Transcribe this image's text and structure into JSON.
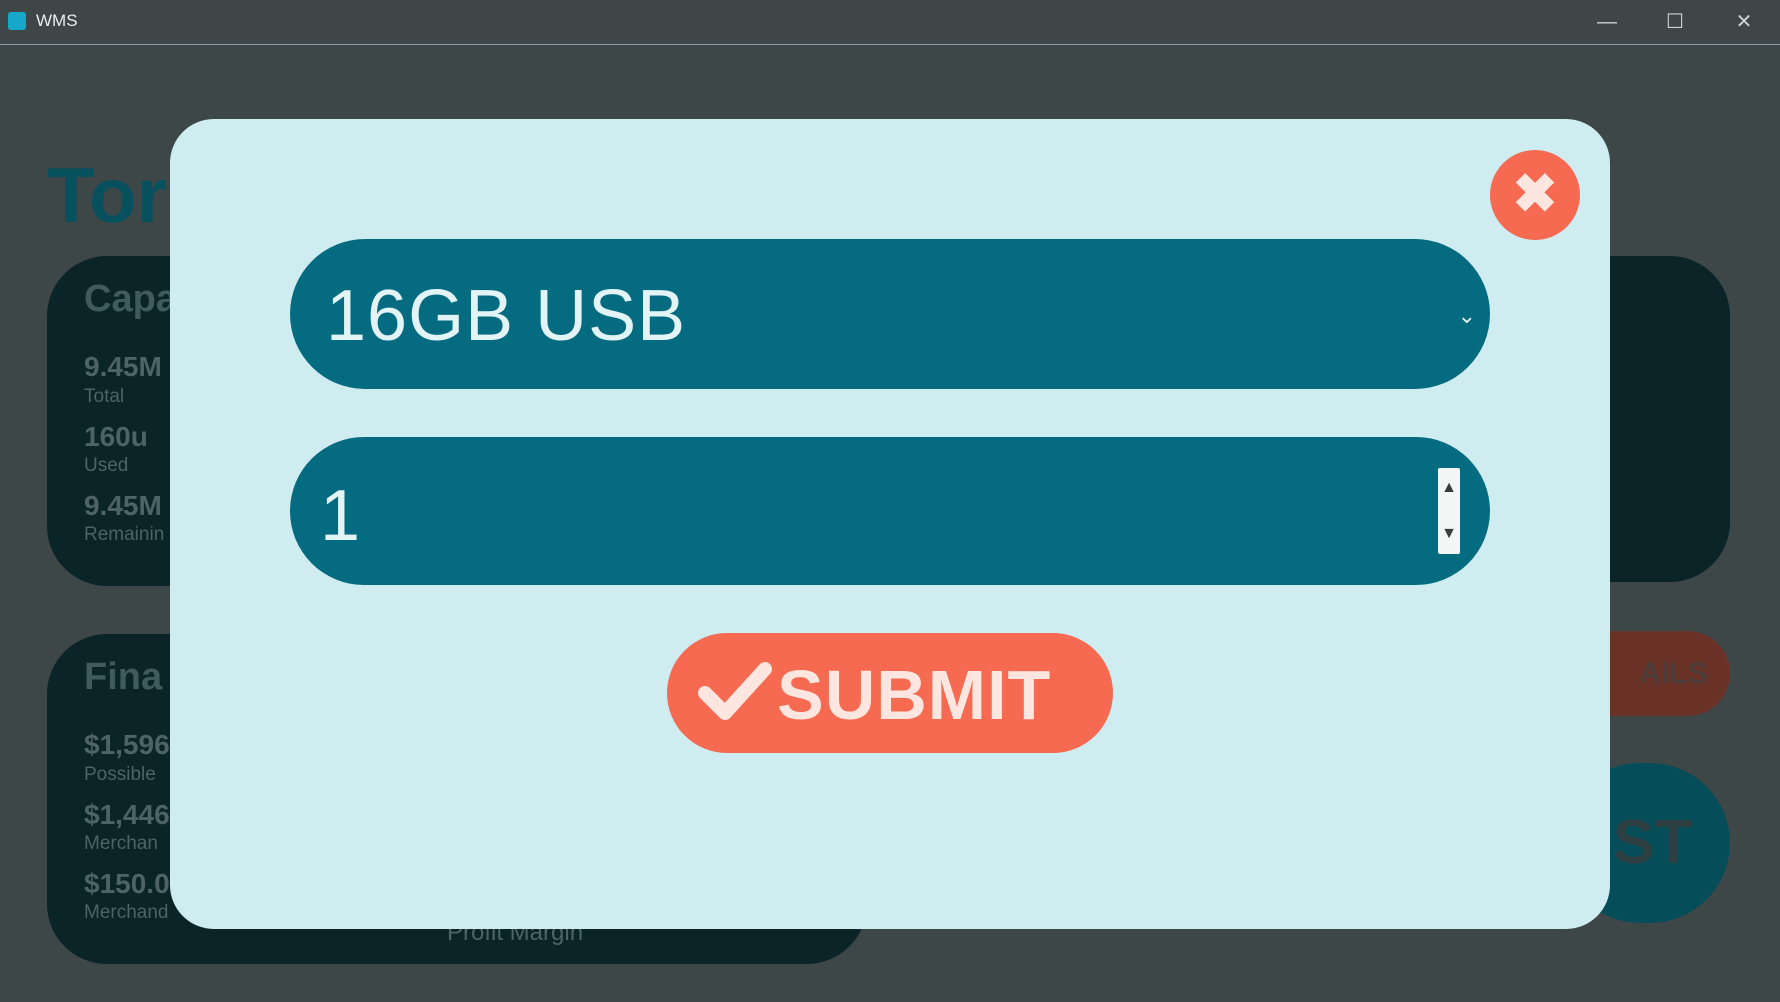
{
  "window": {
    "title": "WMS",
    "minimize_glyph": "—",
    "maximize_glyph": "☐",
    "close_glyph": "✕"
  },
  "background": {
    "heading": "Tor",
    "capacity_card": {
      "title": "Capa",
      "stats": [
        {
          "value": "9.45M",
          "label": "Total"
        },
        {
          "value": "160u",
          "label": "Used"
        },
        {
          "value": "9.45M",
          "label": "Remainin"
        }
      ]
    },
    "finance_card": {
      "title": "Fina",
      "stats": [
        {
          "value": "$1,596",
          "label": "Possible"
        },
        {
          "value": "$1,446",
          "label": "Merchan"
        },
        {
          "value": "$150.0",
          "label": "Merchand"
        }
      ],
      "footer_label": "Profit Margin"
    },
    "details_pill_label": "AILS",
    "list_pill_label": "ST"
  },
  "modal": {
    "close_icon": "close-icon",
    "close_glyph": "✖",
    "product_select": {
      "value": "16GB USB",
      "chevron_glyph": "⌄"
    },
    "quantity_input": {
      "value": "1",
      "up_glyph": "▲",
      "down_glyph": "▼"
    },
    "submit_button": {
      "label": "SUBMIT",
      "icon": "check-icon"
    }
  },
  "colors": {
    "overlay": "#3e4748",
    "modal_bg": "#cfecf1",
    "field_bg": "#046b80",
    "accent": "#f56a50"
  }
}
